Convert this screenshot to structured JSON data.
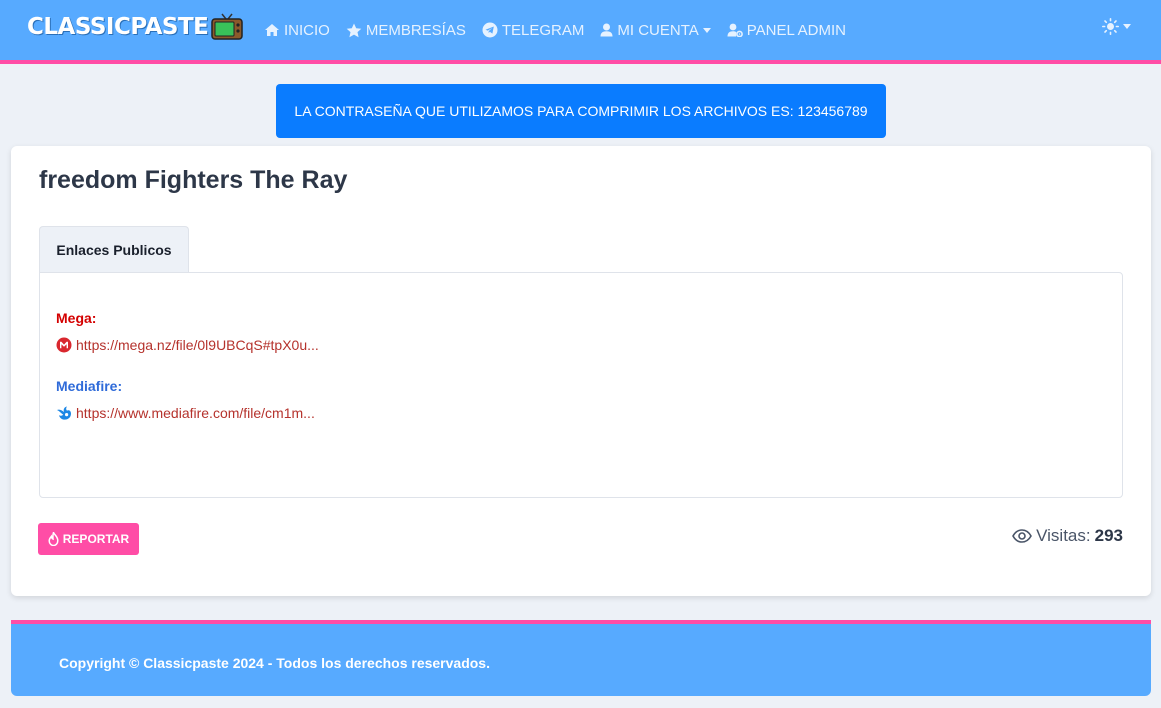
{
  "navbar": {
    "brand": "CLASSICPASTE",
    "items": [
      {
        "label": "INICIO",
        "icon": "home-icon"
      },
      {
        "label": "MEMBRESÍAS",
        "icon": "star-icon"
      },
      {
        "label": "TELEGRAM",
        "icon": "telegram-icon"
      },
      {
        "label": "MI CUENTA",
        "icon": "user-icon",
        "dropdown": true
      },
      {
        "label": "PANEL ADMIN",
        "icon": "user-gear-icon"
      }
    ],
    "theme_icon": "sun-icon"
  },
  "alert": {
    "text": "LA CONTRASEÑA QUE UTILIZAMOS PARA COMPRIMIR LOS ARCHIVOS ES: 123456789"
  },
  "paste": {
    "title": "freedom Fighters The Ray",
    "tab_label": "Enlaces Publicos",
    "links": [
      {
        "label": "Mega:",
        "url": "https://mega.nz/file/0l9UBCqS#tpX0u...",
        "icon": "mega-icon"
      },
      {
        "label": "Mediafire:",
        "url": "https://www.mediafire.com/file/cm1m...",
        "icon": "mediafire-icon"
      }
    ],
    "report_label": "REPORTAR",
    "visits_label": "Visitas:",
    "visits_count": "293"
  },
  "footer": {
    "text": "Copyright © Classicpaste 2024 - Todos los derechos reservados."
  },
  "colors": {
    "navbar": "#57aaff",
    "accent_pink": "#ff4da6",
    "alert_blue": "#0a7cff",
    "link_red": "#b5322c",
    "mega_label": "#d40000",
    "mediafire_label": "#2f6bd9"
  }
}
